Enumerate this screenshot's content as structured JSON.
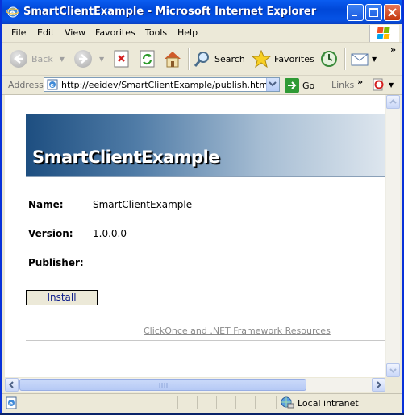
{
  "window": {
    "title": "SmartClientExample - Microsoft Internet Explorer"
  },
  "menu": {
    "items": [
      "File",
      "Edit",
      "View",
      "Favorites",
      "Tools",
      "Help"
    ]
  },
  "toolbar": {
    "back_label": "Back",
    "search_label": "Search",
    "favorites_label": "Favorites"
  },
  "address": {
    "label": "Address",
    "url": "http://eeidev/SmartClientExample/publish.htm",
    "go_label": "Go",
    "links_label": "Links"
  },
  "page": {
    "banner_title": "SmartClientExample",
    "fields": [
      {
        "label": "Name:",
        "value": "SmartClientExample"
      },
      {
        "label": "Version:",
        "value": "1.0.0.0"
      },
      {
        "label": "Publisher:",
        "value": ""
      }
    ],
    "install_label": "Install",
    "resources_link": "ClickOnce and .NET Framework Resources"
  },
  "status": {
    "zone_label": "Local intranet"
  },
  "colors": {
    "titlebar": "#0a5df1",
    "banner_start": "#1d4e80",
    "banner_end": "#dfe7ef"
  }
}
